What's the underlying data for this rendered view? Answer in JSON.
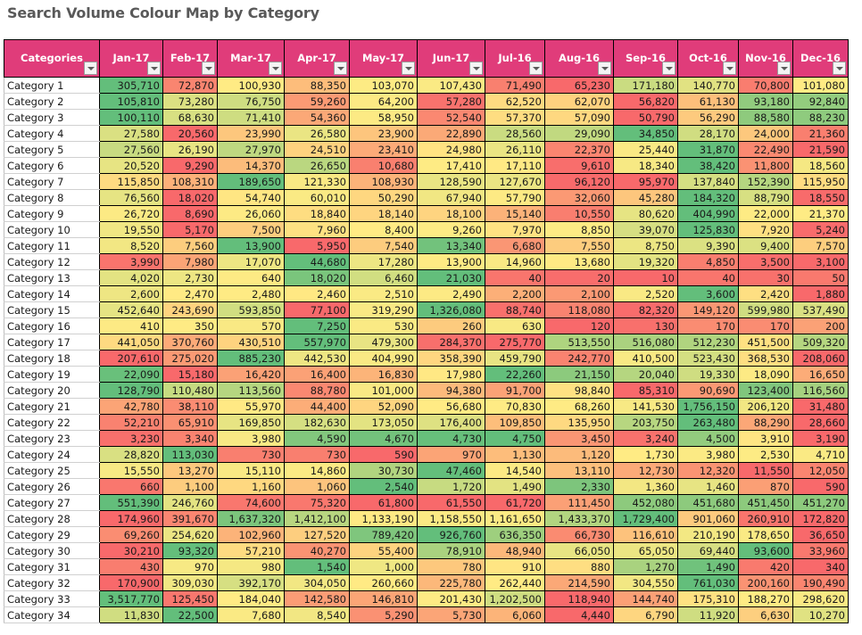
{
  "title": "Search Volume Colour Map by Category",
  "colors": {
    "low": "#F8696B",
    "mid": "#FFEB84",
    "high": "#63BE7B",
    "header_bg": "#E03C7A"
  },
  "header": {
    "first_column": "Categories",
    "months": [
      "Jan-17",
      "Feb-17",
      "Mar-17",
      "Apr-17",
      "May-17",
      "Jun-17",
      "Jul-16",
      "Aug-16",
      "Sep-16",
      "Oct-16",
      "Nov-16",
      "Dec-16"
    ]
  },
  "rows": [
    {
      "category": "Category 1",
      "values": [
        "305,710",
        "72,870",
        "100,930",
        "88,350",
        "103,070",
        "107,430",
        "71,490",
        "65,230",
        "171,180",
        "140,770",
        "70,800",
        "101,080"
      ]
    },
    {
      "category": "Category 2",
      "values": [
        "105,810",
        "73,280",
        "76,750",
        "59,260",
        "64,200",
        "57,280",
        "62,520",
        "62,070",
        "56,820",
        "61,130",
        "93,180",
        "92,840"
      ]
    },
    {
      "category": "Category 3",
      "values": [
        "100,110",
        "68,630",
        "71,410",
        "54,360",
        "58,950",
        "52,540",
        "57,370",
        "57,090",
        "50,790",
        "56,290",
        "88,580",
        "88,230"
      ]
    },
    {
      "category": "Category 4",
      "values": [
        "27,580",
        "20,560",
        "23,990",
        "26,580",
        "23,900",
        "22,890",
        "28,560",
        "29,090",
        "34,850",
        "28,170",
        "24,000",
        "21,360"
      ]
    },
    {
      "category": "Category 5",
      "values": [
        "27,560",
        "26,190",
        "27,970",
        "24,510",
        "23,410",
        "24,980",
        "26,110",
        "22,370",
        "25,440",
        "31,870",
        "22,490",
        "21,590"
      ]
    },
    {
      "category": "Category 6",
      "values": [
        "20,520",
        "9,290",
        "14,370",
        "26,650",
        "10,680",
        "17,410",
        "17,110",
        "9,610",
        "18,340",
        "38,420",
        "11,800",
        "18,560"
      ]
    },
    {
      "category": "Category 7",
      "values": [
        "115,850",
        "108,310",
        "189,650",
        "121,330",
        "108,930",
        "128,590",
        "127,670",
        "96,120",
        "95,970",
        "137,840",
        "152,390",
        "115,950"
      ]
    },
    {
      "category": "Category 8",
      "values": [
        "76,560",
        "18,020",
        "54,740",
        "60,010",
        "50,290",
        "67,940",
        "57,790",
        "32,060",
        "45,280",
        "184,320",
        "88,790",
        "18,550"
      ]
    },
    {
      "category": "Category 9",
      "values": [
        "26,720",
        "8,690",
        "26,060",
        "18,840",
        "18,140",
        "18,100",
        "15,140",
        "10,550",
        "80,620",
        "404,990",
        "22,000",
        "21,370"
      ]
    },
    {
      "category": "Category 10",
      "values": [
        "19,550",
        "5,170",
        "7,500",
        "7,960",
        "8,400",
        "9,260",
        "7,970",
        "8,850",
        "39,070",
        "125,830",
        "7,920",
        "5,240"
      ]
    },
    {
      "category": "Category 11",
      "values": [
        "8,520",
        "7,560",
        "13,900",
        "5,950",
        "7,540",
        "13,340",
        "6,680",
        "7,550",
        "8,750",
        "9,390",
        "9,400",
        "7,570"
      ]
    },
    {
      "category": "Category 12",
      "values": [
        "3,990",
        "7,980",
        "17,070",
        "44,680",
        "17,280",
        "13,900",
        "14,960",
        "13,680",
        "19,320",
        "4,850",
        "3,500",
        "3,100"
      ]
    },
    {
      "category": "Category 13",
      "values": [
        "4,020",
        "2,730",
        "640",
        "18,020",
        "6,460",
        "21,030",
        "40",
        "20",
        "10",
        "40",
        "30",
        "50"
      ]
    },
    {
      "category": "Category 14",
      "values": [
        "2,600",
        "2,470",
        "2,480",
        "2,460",
        "2,510",
        "2,490",
        "2,200",
        "2,100",
        "2,520",
        "3,600",
        "2,420",
        "1,880"
      ]
    },
    {
      "category": "Category 15",
      "values": [
        "452,640",
        "243,690",
        "593,850",
        "77,100",
        "319,290",
        "1,326,080",
        "88,740",
        "118,080",
        "82,320",
        "149,120",
        "599,980",
        "537,490"
      ]
    },
    {
      "category": "Category 16",
      "values": [
        "410",
        "350",
        "570",
        "7,250",
        "530",
        "260",
        "630",
        "120",
        "130",
        "170",
        "170",
        "200"
      ]
    },
    {
      "category": "Category 17",
      "values": [
        "441,050",
        "370,760",
        "430,510",
        "557,970",
        "479,300",
        "284,370",
        "275,770",
        "513,550",
        "516,080",
        "512,230",
        "451,500",
        "509,320"
      ]
    },
    {
      "category": "Category 18",
      "values": [
        "207,610",
        "275,020",
        "885,230",
        "442,530",
        "404,990",
        "358,390",
        "459,790",
        "242,770",
        "410,500",
        "523,430",
        "368,530",
        "208,060"
      ]
    },
    {
      "category": "Category 19",
      "values": [
        "22,090",
        "15,180",
        "16,420",
        "16,400",
        "16,830",
        "17,980",
        "22,260",
        "21,150",
        "20,040",
        "19,330",
        "18,090",
        "16,650"
      ]
    },
    {
      "category": "Category 20",
      "values": [
        "128,790",
        "110,480",
        "113,560",
        "88,780",
        "101,000",
        "94,380",
        "91,700",
        "98,840",
        "85,310",
        "90,690",
        "123,400",
        "116,560"
      ]
    },
    {
      "category": "Category 21",
      "values": [
        "42,780",
        "38,110",
        "55,970",
        "44,400",
        "52,090",
        "56,680",
        "70,830",
        "68,260",
        "141,530",
        "1,756,150",
        "206,120",
        "31,480"
      ]
    },
    {
      "category": "Category 22",
      "values": [
        "52,210",
        "65,910",
        "169,850",
        "182,630",
        "173,050",
        "176,400",
        "109,850",
        "135,950",
        "203,750",
        "263,480",
        "88,290",
        "28,660"
      ]
    },
    {
      "category": "Category 23",
      "values": [
        "3,230",
        "3,340",
        "3,980",
        "4,590",
        "4,670",
        "4,730",
        "4,750",
        "3,450",
        "3,240",
        "4,500",
        "3,910",
        "3,190"
      ]
    },
    {
      "category": "Category 24",
      "values": [
        "28,820",
        "113,030",
        "730",
        "730",
        "590",
        "970",
        "1,130",
        "1,120",
        "1,730",
        "3,980",
        "2,530",
        "4,710"
      ]
    },
    {
      "category": "Category 25",
      "values": [
        "15,550",
        "13,270",
        "15,110",
        "14,860",
        "30,730",
        "47,460",
        "14,540",
        "13,110",
        "12,730",
        "12,320",
        "11,550",
        "12,050"
      ]
    },
    {
      "category": "Category 26",
      "values": [
        "660",
        "1,100",
        "1,160",
        "1,060",
        "2,540",
        "1,720",
        "1,490",
        "2,330",
        "1,360",
        "1,460",
        "870",
        "590"
      ]
    },
    {
      "category": "Category 27",
      "values": [
        "551,390",
        "246,760",
        "74,600",
        "75,320",
        "61,800",
        "61,550",
        "61,720",
        "111,450",
        "452,080",
        "451,680",
        "451,450",
        "451,270"
      ]
    },
    {
      "category": "Category 28",
      "values": [
        "174,960",
        "391,670",
        "1,637,320",
        "1,412,100",
        "1,133,190",
        "1,158,550",
        "1,161,650",
        "1,433,370",
        "1,729,400",
        "901,060",
        "260,910",
        "172,820"
      ]
    },
    {
      "category": "Category 29",
      "values": [
        "69,260",
        "254,620",
        "102,960",
        "127,520",
        "789,420",
        "926,760",
        "636,350",
        "66,730",
        "116,610",
        "210,190",
        "178,650",
        "36,650"
      ]
    },
    {
      "category": "Category 30",
      "values": [
        "30,210",
        "93,320",
        "57,210",
        "40,270",
        "55,400",
        "78,910",
        "48,940",
        "66,050",
        "65,050",
        "69,440",
        "93,600",
        "33,960"
      ]
    },
    {
      "category": "Category 31",
      "values": [
        "430",
        "970",
        "980",
        "1,540",
        "1,000",
        "780",
        "910",
        "880",
        "1,270",
        "1,490",
        "420",
        "340"
      ]
    },
    {
      "category": "Category 32",
      "values": [
        "170,900",
        "309,030",
        "392,170",
        "304,050",
        "260,660",
        "225,780",
        "262,440",
        "214,590",
        "304,550",
        "761,030",
        "200,160",
        "190,490"
      ]
    },
    {
      "category": "Category 33",
      "values": [
        "3,517,770",
        "125,450",
        "184,040",
        "142,580",
        "146,810",
        "201,430",
        "1,202,500",
        "118,940",
        "144,740",
        "175,310",
        "188,270",
        "298,620"
      ]
    },
    {
      "category": "Category 34",
      "values": [
        "11,830",
        "22,500",
        "7,680",
        "8,540",
        "5,290",
        "5,730",
        "6,060",
        "4,440",
        "6,790",
        "11,920",
        "6,630",
        "10,270"
      ]
    }
  ]
}
